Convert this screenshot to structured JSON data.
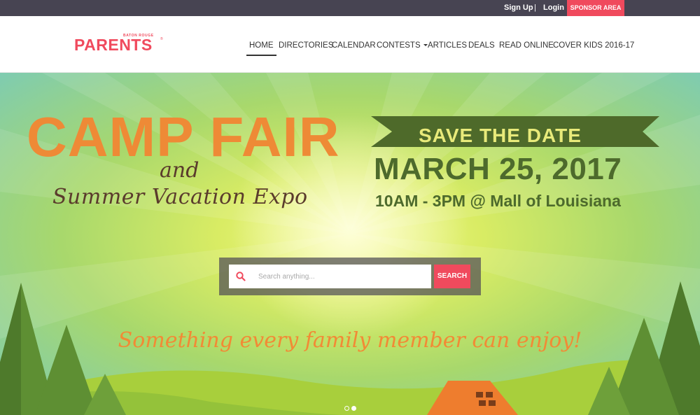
{
  "topbar": {
    "signup_label": "Sign Up",
    "separator": "|",
    "login_label": "Login",
    "sponsor_label": "SPONSOR AREA"
  },
  "logo": {
    "small_text": "BATON ROUGE",
    "main_text": "PARENTS",
    "trademark": "®"
  },
  "nav": {
    "items": [
      {
        "label": "HOME"
      },
      {
        "label": "DIRECTORIES"
      },
      {
        "label": "CALENDAR"
      },
      {
        "label": "CONTESTS"
      },
      {
        "label": "ARTICLES"
      },
      {
        "label": "DEALS"
      },
      {
        "label": "READ ONLINE"
      },
      {
        "label": "COVER KIDS 2016-17"
      }
    ]
  },
  "hero": {
    "title": "CAMP FAIR",
    "title_and": "and",
    "subtitle": "Summer Vacation Expo",
    "banner": "SAVE THE DATE",
    "date": "MARCH 25, 2017",
    "time_location": "10AM - 3PM @ Mall of Louisiana",
    "tagline": "Something every family member can enjoy!"
  },
  "search": {
    "placeholder": "Search anything...",
    "button_label": "SEARCH",
    "icon": "search-icon"
  },
  "slider": {
    "slide_count": 2,
    "active_slide": 2
  },
  "colors": {
    "brand": "#f04a5d",
    "topbar": "#474452",
    "camp_orange": "#ee8a36",
    "banner_green": "#4e6a2a",
    "date_green": "#4d6a2c"
  }
}
